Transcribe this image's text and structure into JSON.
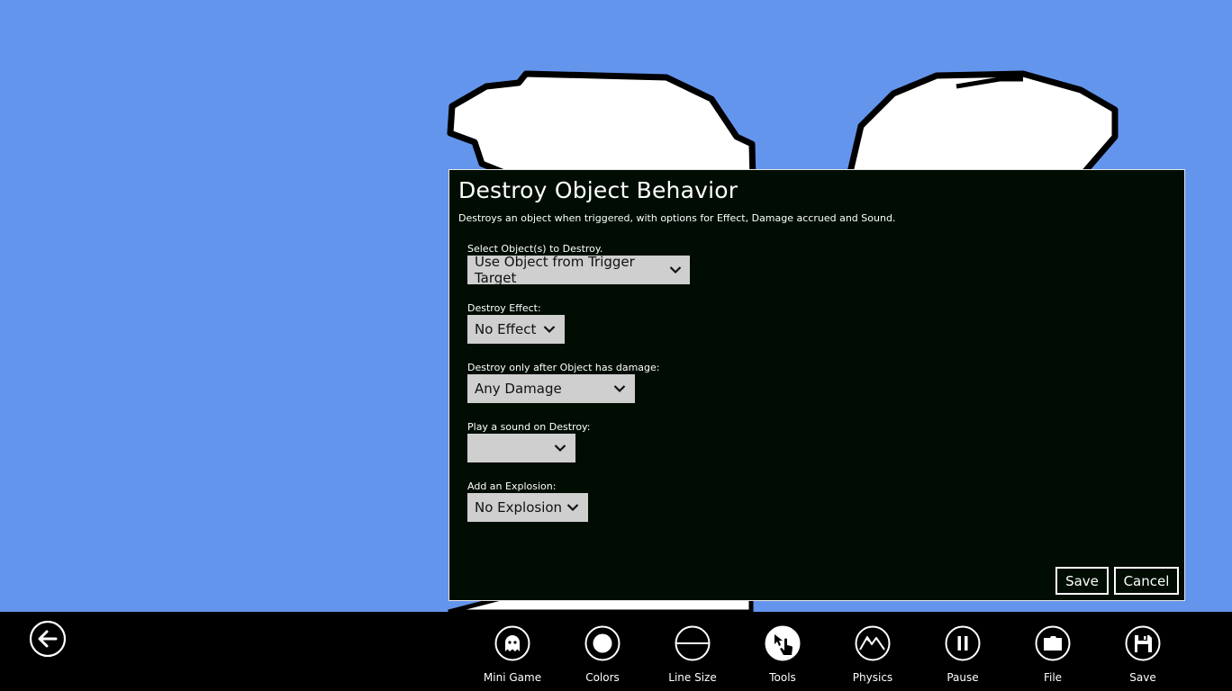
{
  "dialog": {
    "title": "Destroy Object Behavior",
    "subtitle": "Destroys an object when triggered, with options for Effect, Damage accrued and Sound.",
    "fields": [
      {
        "label": "Select Object(s) to Destroy.",
        "value": "Use Object from Trigger Target"
      },
      {
        "label": "Destroy Effect:",
        "value": "No Effect"
      },
      {
        "label": "Destroy only after Object has damage:",
        "value": "Any Damage"
      },
      {
        "label": "Play a sound on Destroy:",
        "value": ""
      },
      {
        "label": "Add an Explosion:",
        "value": "No Explosion"
      }
    ],
    "save_label": "Save",
    "cancel_label": "Cancel"
  },
  "appbar": {
    "tools": [
      {
        "label": "Mini Game",
        "icon": "ghost-icon"
      },
      {
        "label": "Colors",
        "icon": "circle-fill-icon"
      },
      {
        "label": "Line Size",
        "icon": "line-size-icon"
      },
      {
        "label": "Tools",
        "icon": "hand-pointer-icon"
      },
      {
        "label": "Physics",
        "icon": "mountain-icon"
      },
      {
        "label": "Pause",
        "icon": "pause-icon"
      },
      {
        "label": "File",
        "icon": "folder-icon"
      },
      {
        "label": "Save",
        "icon": "floppy-disk-icon"
      }
    ]
  },
  "colors": {
    "background": "#6495ed",
    "dialog_bg": "#010d03",
    "select_bg": "#cfcfcf",
    "appbar_bg": "#000000"
  }
}
